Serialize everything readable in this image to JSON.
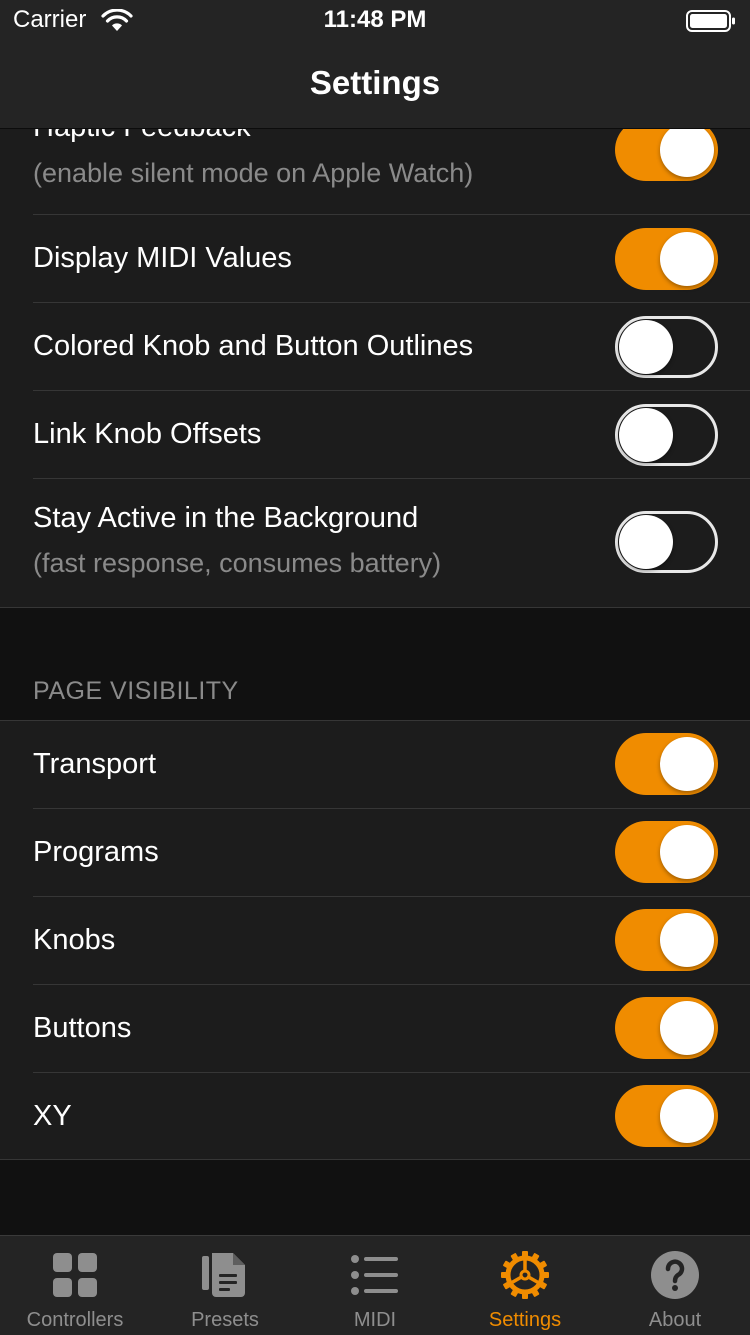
{
  "status_bar": {
    "carrier": "Carrier",
    "time": "11:48 PM"
  },
  "nav": {
    "title": "Settings"
  },
  "general": {
    "rows": [
      {
        "title": "Haptic Feedback",
        "subtitle": "(enable silent mode on Apple Watch)",
        "on": true
      },
      {
        "title": "Display MIDI Values",
        "on": true
      },
      {
        "title": "Colored Knob and Button Outlines",
        "on": false
      },
      {
        "title": "Link Knob Offsets",
        "on": false
      },
      {
        "title": "Stay Active in the Background",
        "subtitle": "(fast response, consumes battery)",
        "on": false
      }
    ]
  },
  "page_visibility": {
    "header": "PAGE VISIBILITY",
    "rows": [
      {
        "title": "Transport",
        "on": true
      },
      {
        "title": "Programs",
        "on": true
      },
      {
        "title": "Knobs",
        "on": true
      },
      {
        "title": "Buttons",
        "on": true
      },
      {
        "title": "XY",
        "on": true
      }
    ]
  },
  "tab_bar": {
    "tabs": [
      {
        "label": "Controllers",
        "icon": "grid-icon"
      },
      {
        "label": "Presets",
        "icon": "document-icon"
      },
      {
        "label": "MIDI",
        "icon": "list-icon"
      },
      {
        "label": "Settings",
        "icon": "gear-icon"
      },
      {
        "label": "About",
        "icon": "question-icon"
      }
    ],
    "active": "Settings"
  },
  "colors": {
    "accent": "#f08c00",
    "background": "#111111",
    "cell": "#1c1c1c",
    "bar": "#242424",
    "secondary_text": "#8a8a8a"
  }
}
